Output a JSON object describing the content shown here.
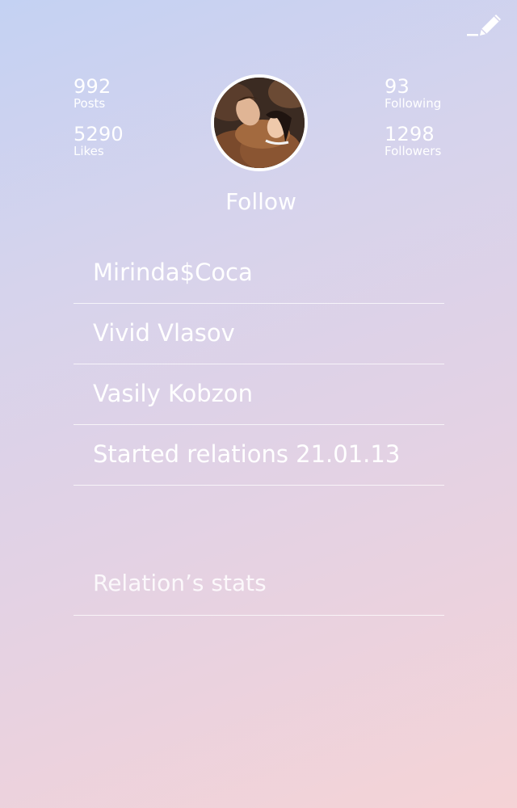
{
  "toolbar": {
    "edit_icon": "pencil-icon"
  },
  "stats": {
    "posts": {
      "value": "992",
      "label": "Posts"
    },
    "likes": {
      "value": "5290",
      "label": "Likes"
    },
    "following": {
      "value": "93",
      "label": "Following"
    },
    "followers": {
      "value": "1298",
      "label": "Followers"
    }
  },
  "profile": {
    "follow_label": "Follow"
  },
  "details": [
    {
      "text": "Mirinda$Coca"
    },
    {
      "text": "Vivid Vlasov"
    },
    {
      "text": "Vasily Kobzon"
    },
    {
      "text": "Started relations 21.01.13"
    }
  ],
  "relation_stats_label": "Relation’s stats",
  "colors": {
    "gradient_top": "#c4d2f3",
    "gradient_bottom": "#f5d3d6",
    "text": "#ffffff"
  }
}
